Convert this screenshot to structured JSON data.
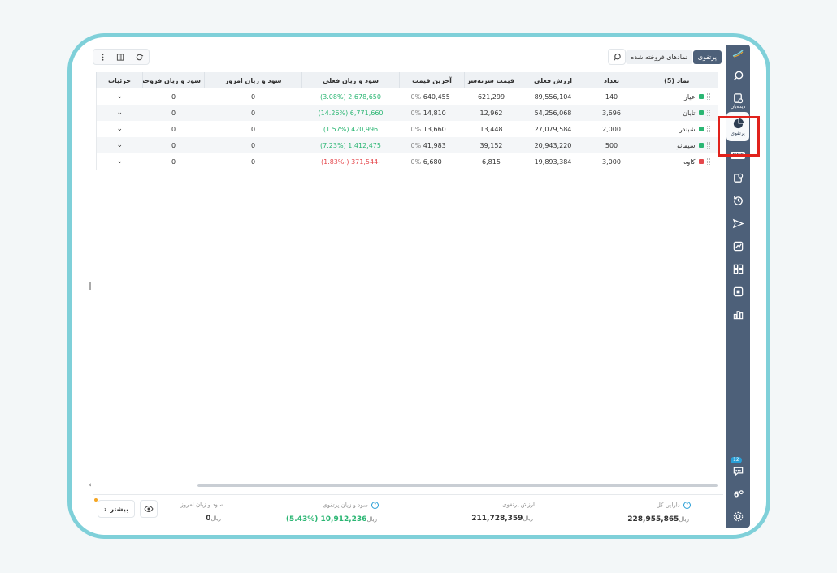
{
  "tabs": {
    "active": "پرتفوی",
    "sold": "نمادهای فروخته شده"
  },
  "table": {
    "headers": {
      "symbol": "نماد (5)",
      "quantity": "تعداد",
      "current_value": "ارزش فعلی",
      "breakeven": "قیمت سربه‌سر",
      "last_price": "آخرین قیمت",
      "current_pl": "سود و زیان فعلی",
      "today_pl": "سود و زیان امروز",
      "sold_pl": "سود و زیان فروخته ش",
      "details": "جزئیات"
    },
    "rows": [
      {
        "symbol": "عیار",
        "color": "#2bb673",
        "quantity": "140",
        "current_value": "89,556,104",
        "breakeven": "621,299",
        "last_pct": "0%",
        "last_price": "640,455",
        "current_pl": "2,678,650 (3.08%)",
        "pl_sign": "pos",
        "today_pl": "0",
        "sold_pl": "0"
      },
      {
        "symbol": "تابان",
        "color": "#2bb673",
        "quantity": "3,696",
        "current_value": "54,256,068",
        "breakeven": "12,962",
        "last_pct": "0%",
        "last_price": "14,810",
        "current_pl": "6,771,660 (14.26%)",
        "pl_sign": "pos",
        "today_pl": "0",
        "sold_pl": "0"
      },
      {
        "symbol": "شبندر",
        "color": "#2bb673",
        "quantity": "2,000",
        "current_value": "27,079,584",
        "breakeven": "13,448",
        "last_pct": "0%",
        "last_price": "13,660",
        "current_pl": "420,996 (1.57%)",
        "pl_sign": "pos",
        "today_pl": "0",
        "sold_pl": "0"
      },
      {
        "symbol": "سیمانو",
        "color": "#2bb673",
        "quantity": "500",
        "current_value": "20,943,220",
        "breakeven": "39,152",
        "last_pct": "0%",
        "last_price": "41,983",
        "current_pl": "1,412,475 (7.23%)",
        "pl_sign": "pos",
        "today_pl": "0",
        "sold_pl": "0"
      },
      {
        "symbol": "کاوه",
        "color": "#e5484d",
        "quantity": "3,000",
        "current_value": "19,893,384",
        "breakeven": "6,815",
        "last_pct": "0%",
        "last_price": "6,680",
        "current_pl": "-371,544 (-1.83%)",
        "pl_sign": "neg",
        "today_pl": "0",
        "sold_pl": "0"
      }
    ]
  },
  "footer": {
    "total_assets_label": "دارایی کل",
    "total_assets": "228,955,865",
    "portfolio_value_label": "ارزش پرتفوی",
    "portfolio_value": "211,728,359",
    "portfolio_pl_label": "سود و زیان پرتفوی",
    "portfolio_pl": "10,912,236 (%5.43)",
    "today_pl_label": "سود و زیان امروز",
    "today_pl": "0",
    "unit": "ریال",
    "more": "بیشتر"
  },
  "rail": {
    "watchlist_label": "دیده‌بان",
    "portfolio_label": "پرتفوی",
    "opt_label": "OPT",
    "chat_badge": "12"
  },
  "colors": {
    "rail": "#4d6079",
    "positive": "#2bb673",
    "negative": "#e5484d",
    "accent": "#2a9fd6",
    "highlight": "#e1221c"
  }
}
